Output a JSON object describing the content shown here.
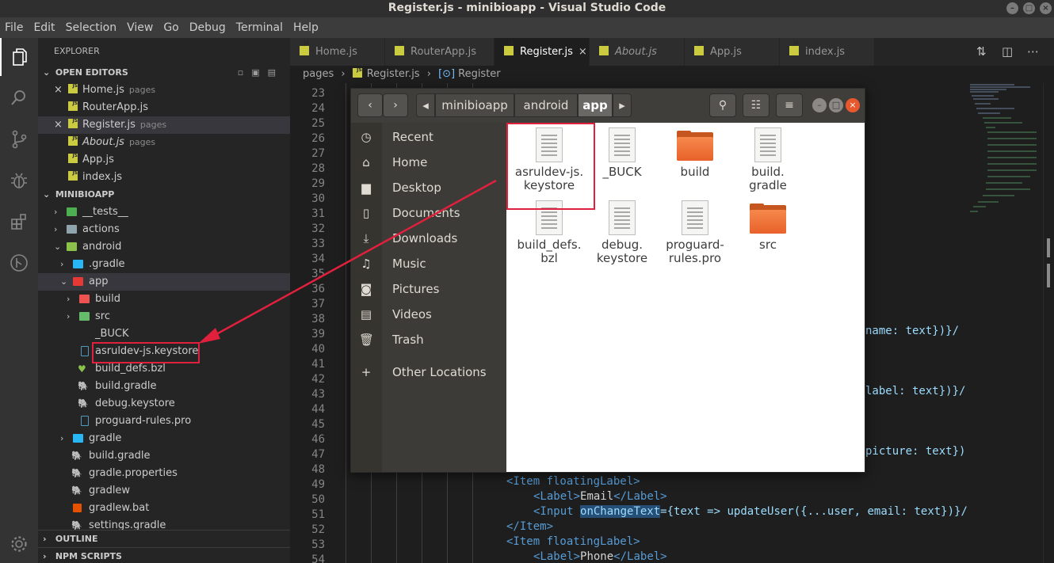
{
  "window": {
    "title": "Register.js - minibioapp - Visual Studio Code"
  },
  "menu": [
    "File",
    "Edit",
    "Selection",
    "View",
    "Go",
    "Debug",
    "Terminal",
    "Help"
  ],
  "explorer": {
    "title": "EXPLORER",
    "open_editors": {
      "header": "OPEN EDITORS",
      "items": [
        {
          "name": "Home.js",
          "hint": "pages",
          "italic": false
        },
        {
          "name": "RouterApp.js",
          "hint": "",
          "italic": false
        },
        {
          "name": "Register.js",
          "hint": "pages",
          "italic": false
        },
        {
          "name": "About.js",
          "hint": "pages",
          "italic": true
        },
        {
          "name": "App.js",
          "hint": "",
          "italic": false
        },
        {
          "name": "index.js",
          "hint": "",
          "italic": false
        }
      ]
    },
    "project": {
      "header": "MINIBIOAPP",
      "tree": [
        {
          "name": "__tests__",
          "type": "folder",
          "color": "#4caf50"
        },
        {
          "name": "actions",
          "type": "folder",
          "color": "#90a4ae"
        },
        {
          "name": "android",
          "type": "folder",
          "color": "#8bc34a"
        },
        {
          "name": ".gradle",
          "type": "folder",
          "color": "#29b6f6"
        },
        {
          "name": "app",
          "type": "folder",
          "color": "#e53935"
        },
        {
          "name": "build",
          "type": "folder",
          "color": "#ef5350"
        },
        {
          "name": "src",
          "type": "folder",
          "color": "#66bb6a"
        },
        {
          "name": "_BUCK",
          "type": "file"
        },
        {
          "name": "asruldev-js.keystore",
          "type": "file"
        },
        {
          "name": "build_defs.bzl",
          "type": "file"
        },
        {
          "name": "build.gradle",
          "type": "file"
        },
        {
          "name": "debug.keystore",
          "type": "file"
        },
        {
          "name": "proguard-rules.pro",
          "type": "file"
        },
        {
          "name": "gradle",
          "type": "folder",
          "color": "#29b6f6"
        },
        {
          "name": "build.gradle",
          "type": "file"
        },
        {
          "name": "gradle.properties",
          "type": "file"
        },
        {
          "name": "gradlew",
          "type": "file"
        },
        {
          "name": "gradlew.bat",
          "type": "file"
        },
        {
          "name": "settings.gradle",
          "type": "file"
        }
      ]
    },
    "outline": "OUTLINE",
    "npm_scripts": "NPM SCRIPTS"
  },
  "tabs": [
    {
      "label": "Home.js",
      "italic": false,
      "active": false
    },
    {
      "label": "RouterApp.js",
      "italic": false,
      "active": false
    },
    {
      "label": "Register.js",
      "italic": false,
      "active": true
    },
    {
      "label": "About.js",
      "italic": true,
      "active": false
    },
    {
      "label": "App.js",
      "italic": false,
      "active": false
    },
    {
      "label": "index.js",
      "italic": false,
      "active": false
    }
  ],
  "breadcrumb": {
    "folder": "pages",
    "file": "Register.js",
    "symbol": "Register"
  },
  "editor": {
    "line_start": 23,
    "line_end": 54,
    "visible_fragments": {
      "l39": "name: text})}/",
      "l43": "label: text})}/",
      "l47": "picture: text})"
    },
    "code": {
      "l49": "<Item floatingLabel>",
      "l50_open": "<Label>",
      "l50_text": "Email",
      "l50_close": "</Label>",
      "l51_input": "<Input",
      "l51_attr": "onChangeText",
      "l51_rest": "={text => updateUser({...user, email: text})}/",
      "l52": "</Item>",
      "l53": "<Item floatingLabel>",
      "l54_open": "<Label>",
      "l54_text": "Phone",
      "l54_close": "</Label>"
    }
  },
  "file_manager": {
    "path": [
      "minibioapp",
      "android",
      "app"
    ],
    "places": [
      "Recent",
      "Home",
      "Desktop",
      "Documents",
      "Downloads",
      "Music",
      "Pictures",
      "Videos",
      "Trash",
      "Other Locations"
    ],
    "files": [
      {
        "line1": "asruldev-js.",
        "line2": "keystore",
        "type": "file"
      },
      {
        "line1": "_BUCK",
        "line2": "",
        "type": "file"
      },
      {
        "line1": "build",
        "line2": "",
        "type": "folder"
      },
      {
        "line1": "build.",
        "line2": "gradle",
        "type": "file"
      },
      {
        "line1": "build_defs.",
        "line2": "bzl",
        "type": "file"
      },
      {
        "line1": "debug.",
        "line2": "keystore",
        "type": "file"
      },
      {
        "line1": "proguard-",
        "line2": "rules.pro",
        "type": "file"
      },
      {
        "line1": "src",
        "line2": "",
        "type": "folder"
      }
    ]
  },
  "colors": {
    "annotation": "#e0203c",
    "js_icon": "#cbcb41",
    "folder_orange": "#e8622a"
  }
}
